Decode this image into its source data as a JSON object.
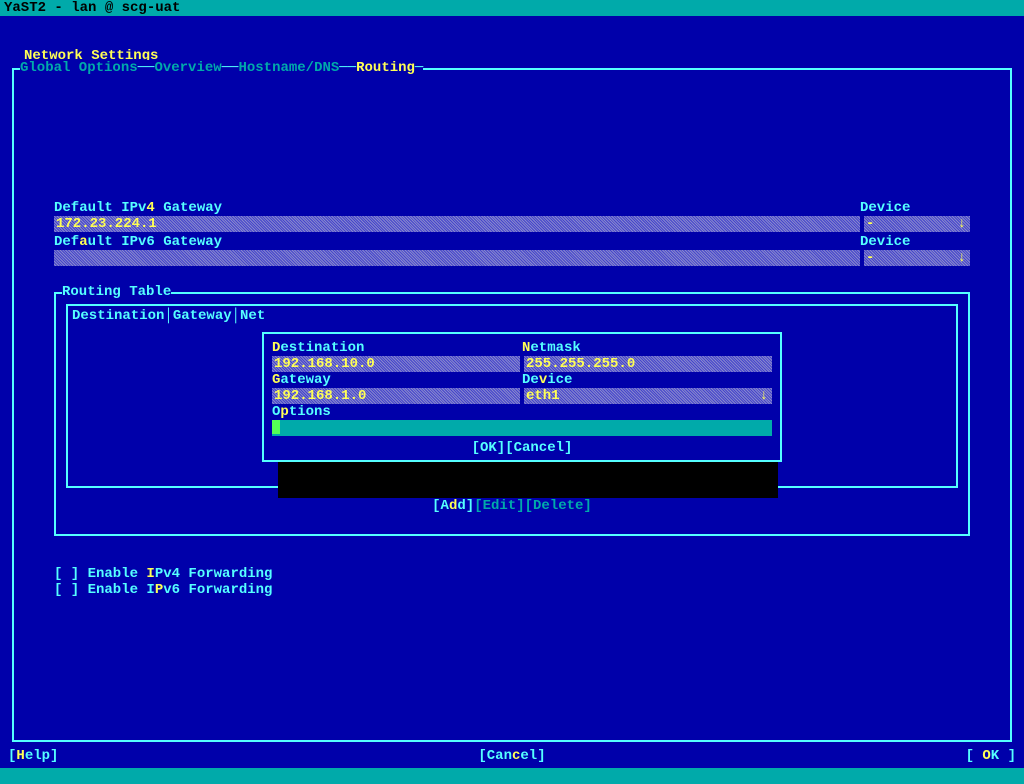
{
  "titlebar": "YaST2 - lan @ scg-uat",
  "page_title": "Network Settings",
  "tabs": {
    "global": "Global Options",
    "overview": "Overview",
    "hostname": "Hostname/DNS",
    "routing": "Routing"
  },
  "gw4_label_pre": "Default IPv",
  "gw4_hl": "4",
  "gw4_label_post": " Gateway",
  "gw4_value": "172.23.224.1",
  "device_label": "Device",
  "gw4_device": "-",
  "gw6_label_pre": "Def",
  "gw6_hl": "a",
  "gw6_label_post": "ult IPv6 Gateway",
  "gw6_value": "",
  "gw6_device": "-",
  "routing_title": "Routing Table",
  "table_headers": "Destination│Gateway│Net",
  "actions": {
    "add_pre": "[A",
    "add_hl": "d",
    "add_post": "d]",
    "edit": "[Edit]",
    "delete": "[Delete]"
  },
  "dialog": {
    "dest_label_hl": "D",
    "dest_label_post": "estination",
    "dest_value": "192.168.10.0",
    "netmask_label_hl": "N",
    "netmask_label_post": "etmask",
    "netmask_value": "255.255.255.0",
    "gateway_label_hl": "G",
    "gateway_label_post": "ateway",
    "gateway_value": "192.168.1.0",
    "device_label_pre": "De",
    "device_label_hl": "v",
    "device_label_post": "ice",
    "device_value": "eth1",
    "options_label_pre": "O",
    "options_label_hl": "p",
    "options_label_post": "tions",
    "ok": "[OK]",
    "cancel": "[Cancel]"
  },
  "checks": {
    "c1_pre": "[ ] Enable ",
    "c1_hl": "I",
    "c1_post": "Pv4 Forwarding",
    "c2_pre": "[ ] Enable I",
    "c2_hl": "P",
    "c2_post": "v6 Forwarding"
  },
  "bottom": {
    "help_pre": "[",
    "help_hl": "H",
    "help_post": "elp]",
    "cancel_pre": "[Can",
    "cancel_hl": "c",
    "cancel_post": "el]",
    "ok_pre": "[ ",
    "ok_hl": "O",
    "ok_post": "K ]"
  }
}
